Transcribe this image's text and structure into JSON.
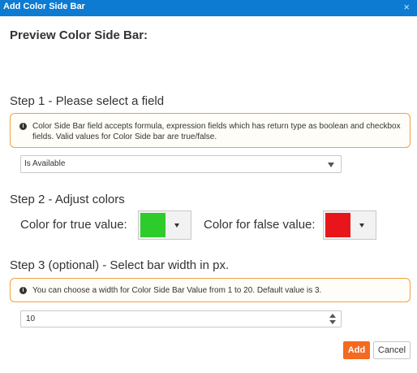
{
  "dialog": {
    "title": "Add Color Side Bar",
    "close_glyph": "×"
  },
  "preview": {
    "heading": "Preview Color Side Bar:"
  },
  "step1": {
    "heading": "Step 1 - Please select a field",
    "info": "Color Side Bar field accepts formula, expression fields which has return type as boolean and checkbox fields. Valid values for Color Side bar are true/false.",
    "field_select_value": "Is Available"
  },
  "step2": {
    "heading": "Step 2 - Adjust colors",
    "true_label": "Color for true value:",
    "false_label": "Color for false value:",
    "true_color": "#2ecc2a",
    "false_color": "#e8161b"
  },
  "step3": {
    "heading": "Step 3 (optional) - Select bar width in px.",
    "info": "You can choose a width for Color Side Bar Value from 1 to 20. Default value is 3.",
    "width_value": "10"
  },
  "buttons": {
    "add": "Add",
    "cancel": "Cancel"
  },
  "colors": {
    "titlebar": "#0c7bd1",
    "accent": "#f46a1f",
    "info_border": "#f0a145"
  },
  "icons": {
    "close": "close-icon",
    "info": "info-icon",
    "dropdown": "chevron-down-icon",
    "spinner": "spinner-arrows-icon"
  }
}
